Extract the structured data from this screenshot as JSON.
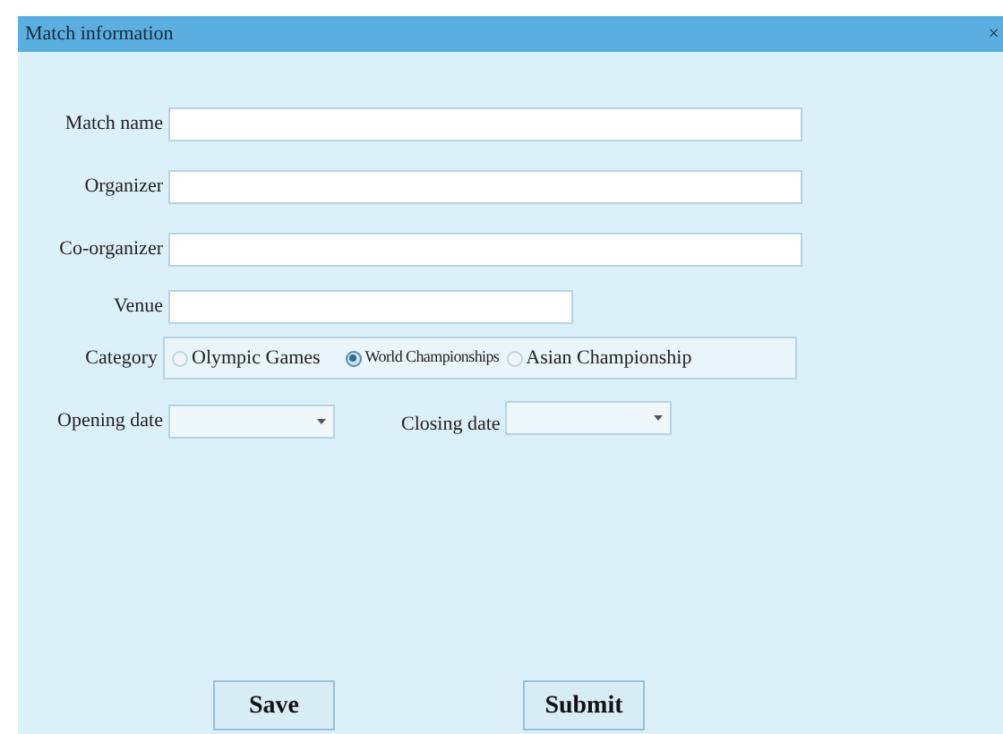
{
  "window": {
    "title": "Match information",
    "close": "×"
  },
  "fields": [
    {
      "label": "Match name"
    },
    {
      "label": "Organizer"
    },
    {
      "label": "Co-organizer"
    },
    {
      "label": "Venue"
    }
  ],
  "category": {
    "label": "Category",
    "options": [
      {
        "label": "Olympic Games",
        "selected": false
      },
      {
        "label": "World Championships",
        "selected": true
      },
      {
        "label": "Asian Championship",
        "selected": false
      }
    ]
  },
  "dates": [
    {
      "label": "Opening date"
    },
    {
      "label": "Closing date"
    }
  ],
  "buttons": [
    "Save",
    "Submit"
  ]
}
